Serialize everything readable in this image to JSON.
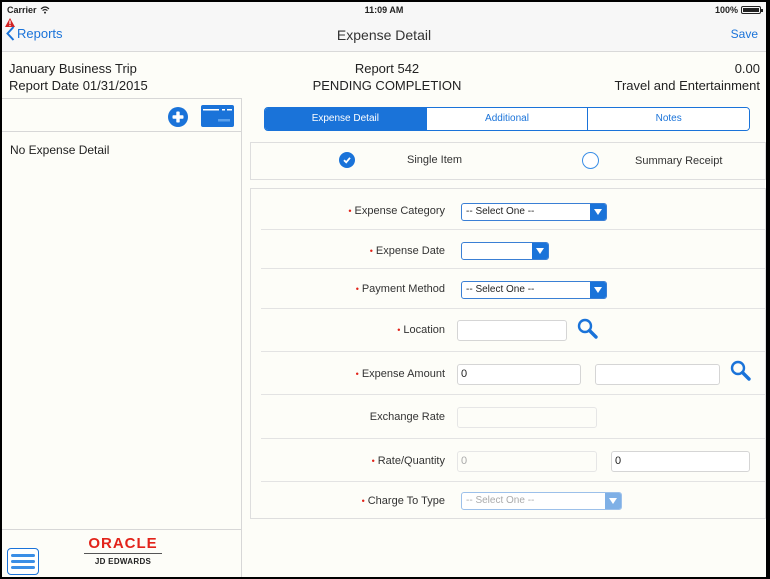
{
  "status_bar": {
    "carrier": "Carrier",
    "time": "11:09 AM",
    "battery": "100%",
    "battery_level": 1.0
  },
  "nav": {
    "back_label": "Reports",
    "title": "Expense Detail",
    "save_label": "Save"
  },
  "header": {
    "trip_name": "January Business Trip",
    "report_date": "Report Date 01/31/2015",
    "report_number": "Report 542",
    "status": "PENDING COMPLETION",
    "amount": "0.00",
    "report_type": "Travel and Entertainment"
  },
  "left_panel": {
    "empty_text": "No Expense Detail",
    "logo_top": "ORACLE",
    "logo_bottom": "JD EDWARDS"
  },
  "tabs": [
    {
      "label": "Expense Detail",
      "active": true
    },
    {
      "label": "Additional",
      "active": false
    },
    {
      "label": "Notes",
      "active": false
    }
  ],
  "receipt_type": {
    "options": [
      {
        "label": "Single Item",
        "selected": true
      },
      {
        "label": "Summary Receipt",
        "selected": false
      }
    ]
  },
  "form": {
    "expense_category": {
      "label": "Expense Category",
      "value": "-- Select One --",
      "required": true
    },
    "expense_date": {
      "label": "Expense Date",
      "value": "",
      "required": true
    },
    "payment_method": {
      "label": "Payment Method",
      "value": "-- Select One --",
      "required": true
    },
    "location": {
      "label": "Location",
      "value": "",
      "required": true
    },
    "expense_amount": {
      "label": "Expense Amount",
      "value": "0",
      "currency": "",
      "required": true
    },
    "exchange_rate": {
      "label": "Exchange Rate",
      "value": "",
      "required": false
    },
    "rate_quantity": {
      "label": "Rate/Quantity",
      "rate": "0",
      "quantity": "0",
      "required": true
    },
    "charge_to_type": {
      "label": "Charge To Type",
      "value": "-- Select One --",
      "required": true
    }
  },
  "colors": {
    "accent": "#1a73d9",
    "required": "#e2231a",
    "oracle_red": "#e2231a"
  }
}
